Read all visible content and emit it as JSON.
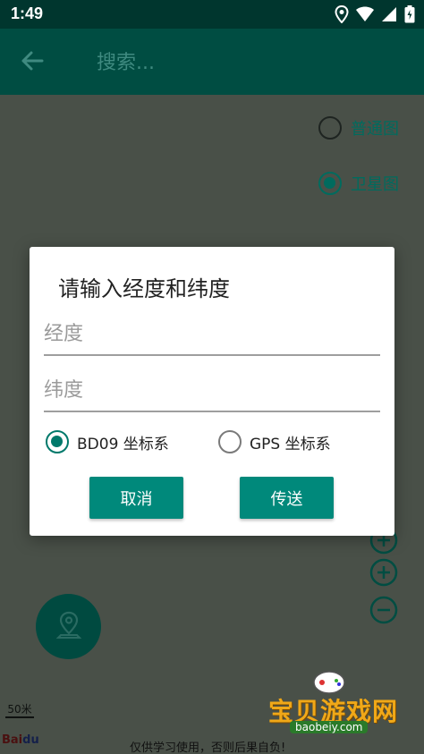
{
  "status_bar": {
    "time": "1:49"
  },
  "app_bar": {
    "search_placeholder": "搜索..."
  },
  "map": {
    "map_type_options": [
      {
        "label": "普通图",
        "selected": false
      },
      {
        "label": "卫星图",
        "selected": true
      }
    ],
    "scale_label": "50米",
    "disclaimer": "仅供学习使用，否则后果自负!",
    "logo_text": "Bai",
    "logo_text_2": "du"
  },
  "dialog": {
    "title": "请输入经度和纬度",
    "longitude_placeholder": "经度",
    "latitude_placeholder": "纬度",
    "coord_options": [
      {
        "label": "BD09 坐标系",
        "selected": true
      },
      {
        "label": "GPS 坐标系",
        "selected": false
      }
    ],
    "cancel_label": "取消",
    "send_label": "传送"
  },
  "watermark": {
    "title": "宝贝游戏网",
    "url": "baobeiy.com"
  },
  "colors": {
    "primary": "#00897b",
    "app_bar": "#004d42",
    "status_bar": "#00362e"
  }
}
